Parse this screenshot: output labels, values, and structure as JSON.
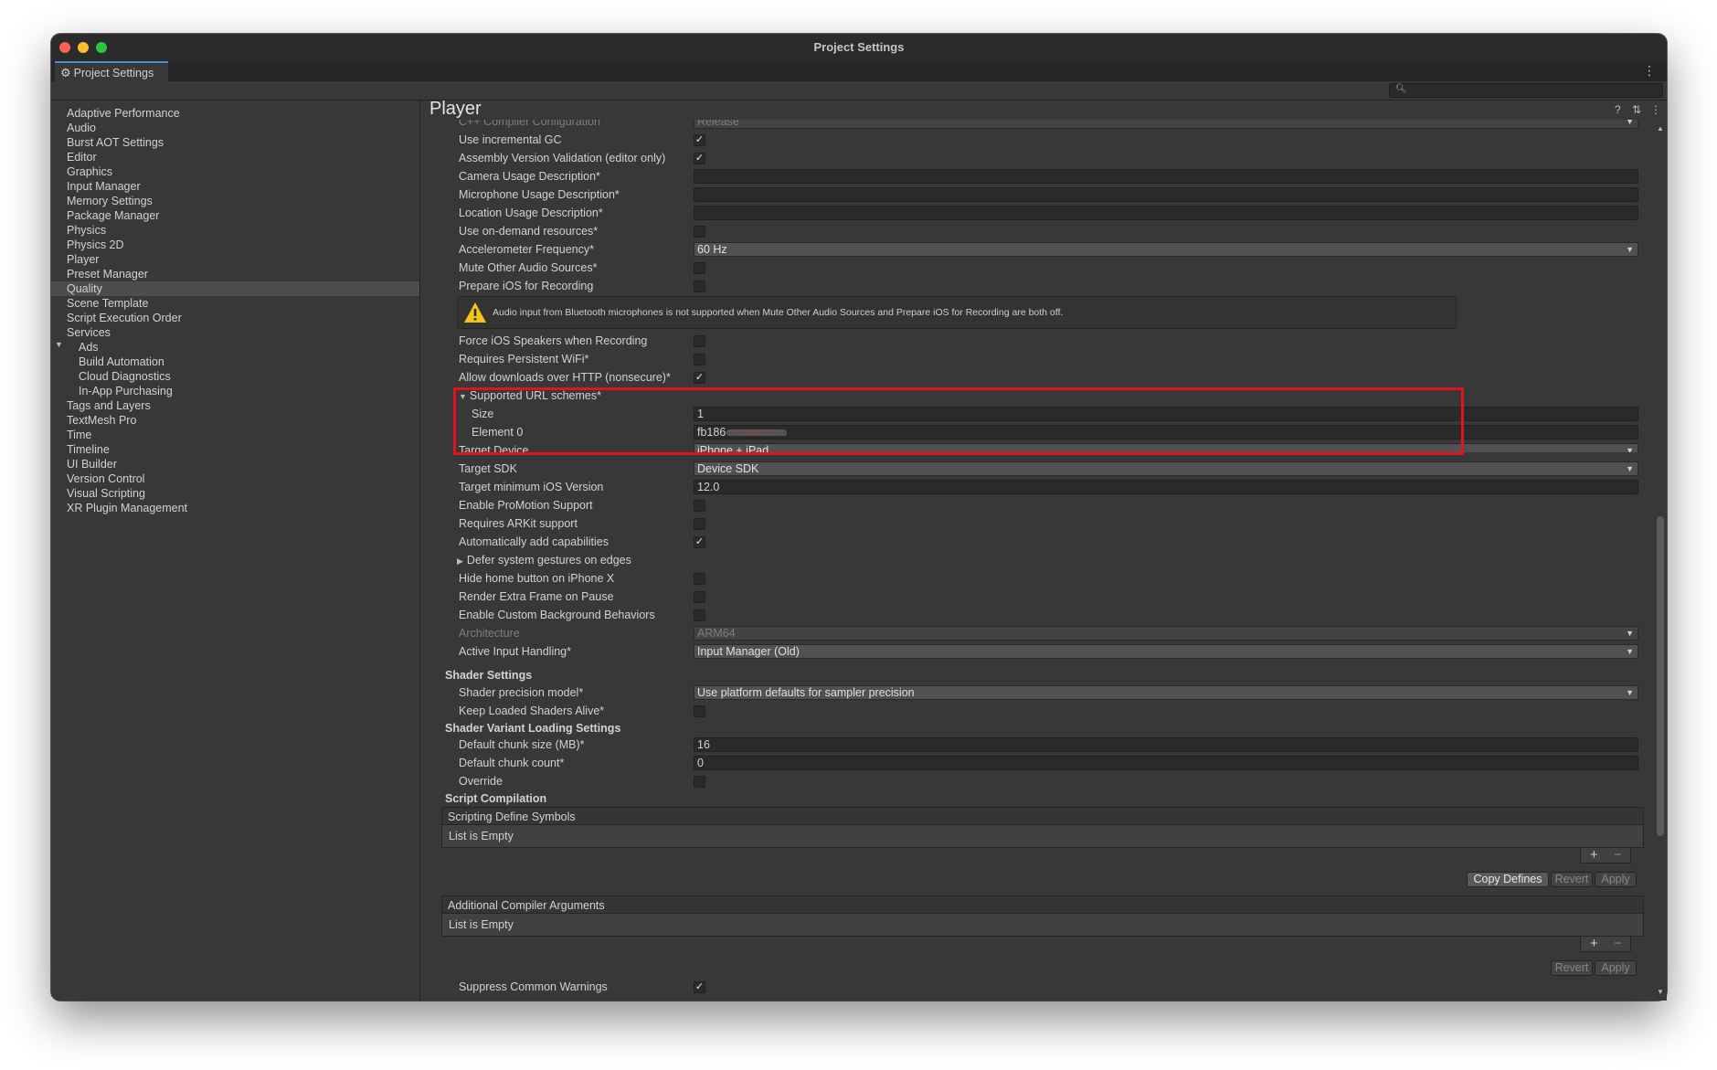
{
  "window": {
    "title": "Project Settings",
    "tab_label": "Project Settings"
  },
  "sidebar": {
    "items": [
      {
        "label": "Adaptive Performance"
      },
      {
        "label": "Audio"
      },
      {
        "label": "Burst AOT Settings"
      },
      {
        "label": "Editor"
      },
      {
        "label": "Graphics"
      },
      {
        "label": "Input Manager"
      },
      {
        "label": "Memory Settings"
      },
      {
        "label": "Package Manager"
      },
      {
        "label": "Physics"
      },
      {
        "label": "Physics 2D"
      },
      {
        "label": "Player",
        "selected": true
      },
      {
        "label": "Preset Manager"
      },
      {
        "label": "Quality"
      },
      {
        "label": "Scene Template"
      },
      {
        "label": "Script Execution Order"
      },
      {
        "label": "Services",
        "expanded": true
      },
      {
        "label": "Ads",
        "child": true
      },
      {
        "label": "Build Automation",
        "child": true
      },
      {
        "label": "Cloud Diagnostics",
        "child": true
      },
      {
        "label": "In-App Purchasing",
        "child": true
      },
      {
        "label": "Tags and Layers"
      },
      {
        "label": "TextMesh Pro"
      },
      {
        "label": "Time"
      },
      {
        "label": "Timeline"
      },
      {
        "label": "UI Builder"
      },
      {
        "label": "Version Control"
      },
      {
        "label": "Visual Scripting"
      },
      {
        "label": "XR Plugin Management"
      }
    ]
  },
  "main": {
    "title": "Player",
    "rows": {
      "cpp_compiler": {
        "label": "C++ Compiler Configuration",
        "value": "Release"
      },
      "incremental_gc": {
        "label": "Use incremental GC",
        "checked": true
      },
      "assembly_validation": {
        "label": "Assembly Version Validation (editor only)",
        "checked": true
      },
      "camera_usage": {
        "label": "Camera Usage Description*",
        "value": ""
      },
      "microphone_usage": {
        "label": "Microphone Usage Description*",
        "value": ""
      },
      "location_usage": {
        "label": "Location Usage Description*",
        "value": ""
      },
      "on_demand_resources": {
        "label": "Use on-demand resources*",
        "checked": false
      },
      "accelerometer": {
        "label": "Accelerometer Frequency*",
        "value": "60 Hz"
      },
      "mute_audio": {
        "label": "Mute Other Audio Sources*",
        "checked": false
      },
      "prepare_recording": {
        "label": "Prepare iOS for Recording",
        "checked": false
      },
      "warning": "Audio input from Bluetooth microphones is not supported when Mute Other Audio Sources and Prepare iOS for Recording are both off.",
      "force_speakers": {
        "label": "Force iOS Speakers when Recording",
        "checked": false
      },
      "persistent_wifi": {
        "label": "Requires Persistent WiFi*",
        "checked": false
      },
      "http_downloads": {
        "label": "Allow downloads over HTTP (nonsecure)*",
        "checked": true
      },
      "url_schemes": {
        "label": "Supported URL schemes*",
        "size_label": "Size",
        "size_value": "1",
        "element_label": "Element 0",
        "element_value": "fb186"
      },
      "target_device": {
        "label": "Target Device",
        "value": "iPhone + iPad"
      },
      "target_sdk": {
        "label": "Target SDK",
        "value": "Device SDK"
      },
      "min_ios": {
        "label": "Target minimum iOS Version",
        "value": "12.0"
      },
      "promotion": {
        "label": "Enable ProMotion Support",
        "checked": false
      },
      "arkit": {
        "label": "Requires ARKit support",
        "checked": false
      },
      "auto_capabilities": {
        "label": "Automatically add capabilities",
        "checked": true
      },
      "defer_gestures": {
        "label": "Defer system gestures on edges"
      },
      "hide_home": {
        "label": "Hide home button on iPhone X",
        "checked": false
      },
      "extra_frame": {
        "label": "Render Extra Frame on Pause",
        "checked": false
      },
      "custom_bg": {
        "label": "Enable Custom Background Behaviors",
        "checked": false
      },
      "architecture": {
        "label": "Architecture",
        "value": "ARM64"
      },
      "input_handling": {
        "label": "Active Input Handling*",
        "value": "Input Manager (Old)"
      }
    },
    "shader_settings": {
      "heading": "Shader Settings",
      "precision": {
        "label": "Shader precision model*",
        "value": "Use platform defaults for sampler precision"
      },
      "keep_loaded": {
        "label": "Keep Loaded Shaders Alive*",
        "checked": false
      }
    },
    "variant_loading": {
      "heading": "Shader Variant Loading Settings",
      "chunk_size": {
        "label": "Default chunk size (MB)*",
        "value": "16"
      },
      "chunk_count": {
        "label": "Default chunk count*",
        "value": "0"
      },
      "override": {
        "label": "Override",
        "checked": false
      }
    },
    "script_compilation": {
      "heading": "Script Compilation",
      "define_symbols": {
        "header": "Scripting Define Symbols",
        "empty": "List is Empty"
      },
      "copy_defines": "Copy Defines",
      "revert": "Revert",
      "apply": "Apply",
      "compiler_args": {
        "header": "Additional Compiler Arguments",
        "empty": "List is Empty"
      },
      "plus": "+",
      "minus": "−",
      "suppress_warnings": {
        "label": "Suppress Common Warnings",
        "checked": true
      }
    }
  },
  "colors": {
    "accent": "#4a8cd8",
    "highlight_box": "#e0141f",
    "selected_row": "#4d4d4d",
    "warning": "#f2c319"
  }
}
